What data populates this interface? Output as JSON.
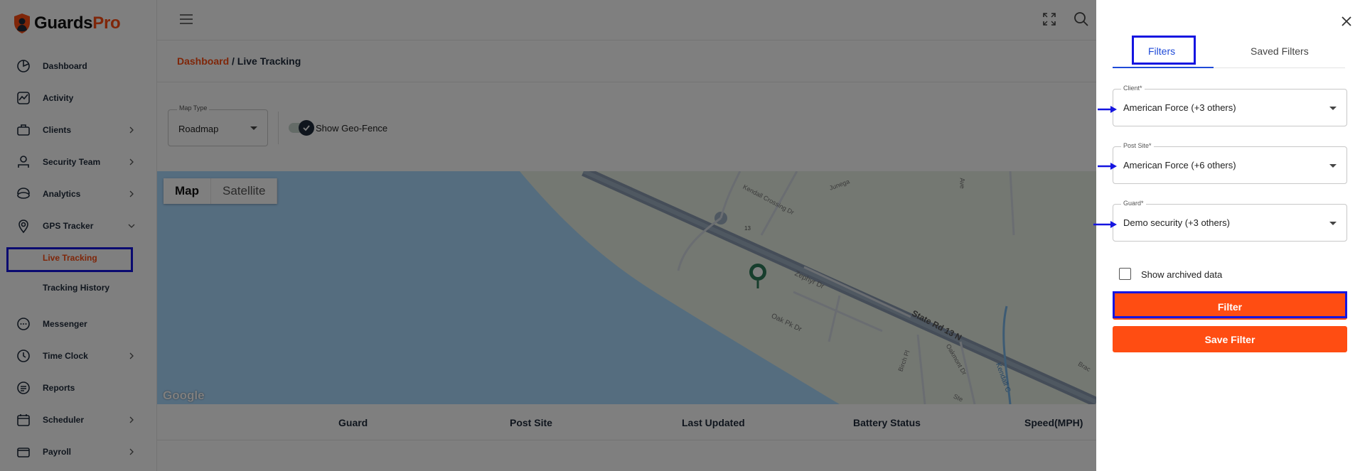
{
  "brand": {
    "part1": "Guards",
    "part2": "Pro"
  },
  "sidebar": {
    "items": [
      {
        "label": "Dashboard",
        "icon": "dashboard-icon"
      },
      {
        "label": "Activity",
        "icon": "activity-icon"
      },
      {
        "label": "Clients",
        "icon": "clients-icon",
        "expandable": true
      },
      {
        "label": "Security Team",
        "icon": "security-team-icon",
        "expandable": true
      },
      {
        "label": "Analytics",
        "icon": "analytics-icon",
        "expandable": true
      },
      {
        "label": "GPS Tracker",
        "icon": "location-pin-icon",
        "expanded": true
      },
      {
        "label": "Messenger",
        "icon": "chat-icon"
      },
      {
        "label": "Time Clock",
        "icon": "clock-icon",
        "expandable": true
      },
      {
        "label": "Reports",
        "icon": "reports-icon"
      },
      {
        "label": "Scheduler",
        "icon": "calendar-icon",
        "expandable": true
      },
      {
        "label": "Payroll",
        "icon": "wallet-icon",
        "expandable": true
      }
    ],
    "gps_sub": [
      {
        "label": "Live Tracking",
        "active": true
      },
      {
        "label": "Tracking History",
        "active": false
      }
    ]
  },
  "breadcrumb": {
    "home": "Dashboard",
    "sep": " / ",
    "current": "Live Tracking"
  },
  "map_type": {
    "label": "Map Type",
    "value": "Roadmap"
  },
  "geofence": {
    "label": "Show Geo-Fence",
    "checked": true
  },
  "map": {
    "buttons": [
      {
        "label": "Map",
        "active": true
      },
      {
        "label": "Satellite",
        "active": false
      }
    ],
    "attribution": "Google",
    "streets": [
      "Kendall Crossing Dr",
      "Zephyr Dr",
      "Oak Pk Dr",
      "State Rd 13 N",
      "Birch Pl",
      "Oakmont Dr",
      "Kendall C",
      "Junega",
      "Ave",
      "Brac",
      "Ste",
      "13"
    ]
  },
  "table": {
    "headers": [
      "Guard",
      "Post Site",
      "Last Updated",
      "Battery Status",
      "Speed(MPH)"
    ]
  },
  "drawer": {
    "tabs": [
      {
        "label": "Filters",
        "active": true
      },
      {
        "label": "Saved Filters",
        "active": false
      }
    ],
    "client": {
      "label": "Client*",
      "value": "American Force (+3 others)"
    },
    "post_site": {
      "label": "Post Site*",
      "value": "American Force (+6 others)"
    },
    "guard": {
      "label": "Guard*",
      "value": "Demo security (+3 others)"
    },
    "archived": {
      "label": "Show archived data",
      "checked": false
    },
    "filter_button": "Filter",
    "save_button": "Save Filter"
  },
  "colors": {
    "accent": "#ff4d12",
    "annotation": "#1515e0",
    "tab": "#1f4ad8",
    "water": "#aadaff",
    "land": "#e8f0e4"
  }
}
